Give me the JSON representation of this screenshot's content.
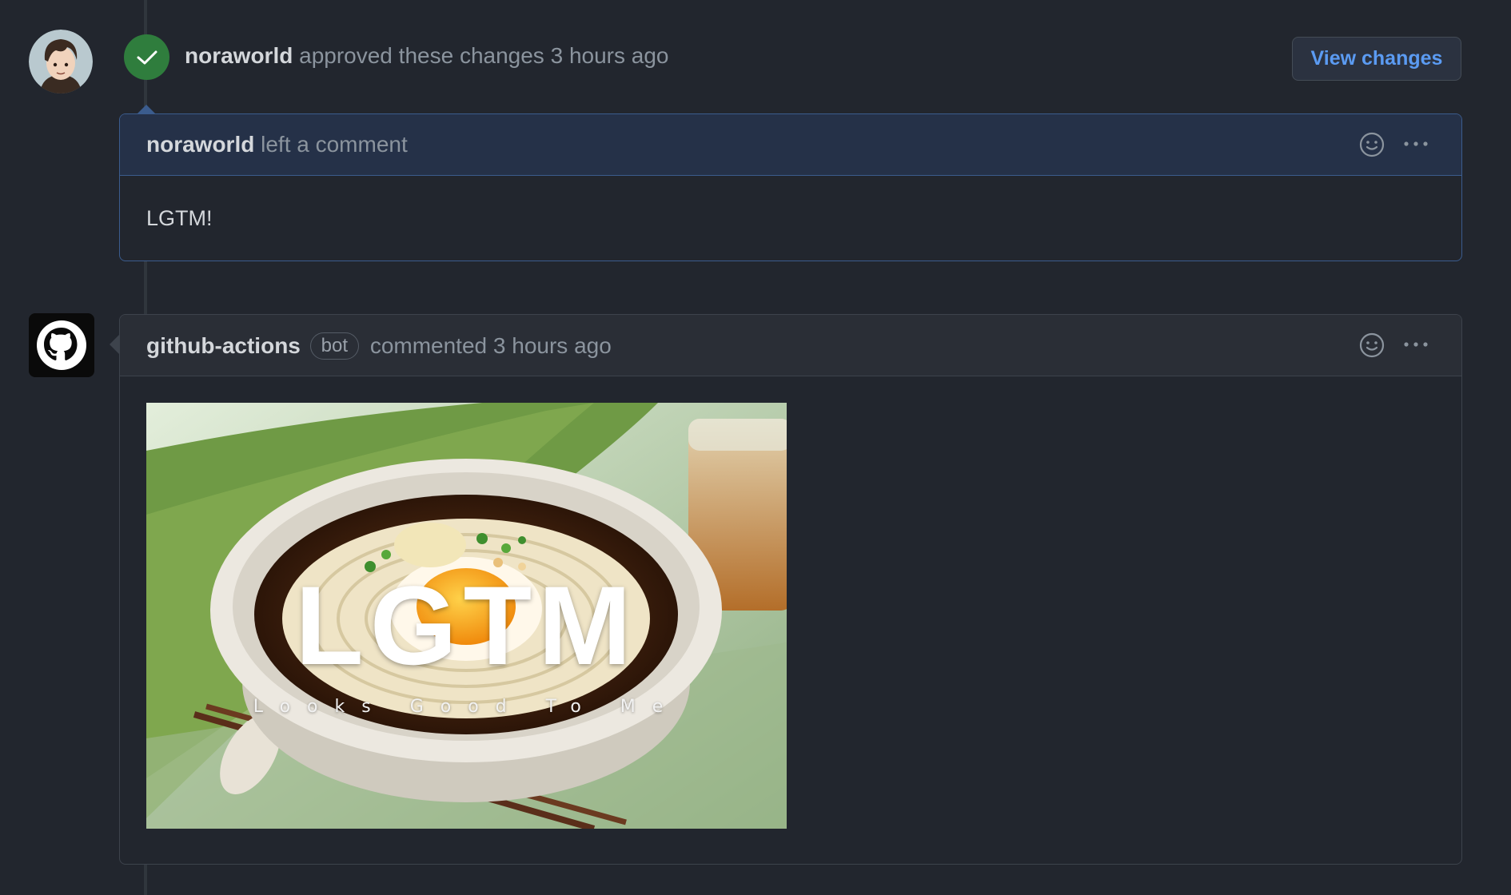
{
  "review": {
    "user": "noraworld",
    "action": "approved these changes",
    "time": "3 hours ago",
    "view_changes_label": "View changes",
    "comment": {
      "user": "noraworld",
      "action": "left a comment",
      "body": "LGTM!"
    }
  },
  "bot_comment": {
    "user": "github-actions",
    "badge": "bot",
    "action": "commented",
    "time": "3 hours ago",
    "image": {
      "title": "LGTM",
      "subtitle": "Looks Good To Me"
    }
  },
  "colors": {
    "background": "#22262e",
    "approved_green": "#2f7d3d",
    "link_blue": "#5b9bf2",
    "highlight_border": "#3b5c8e"
  },
  "icons": [
    "check-icon",
    "smiley-icon",
    "kebab-icon",
    "github-mark-icon"
  ]
}
